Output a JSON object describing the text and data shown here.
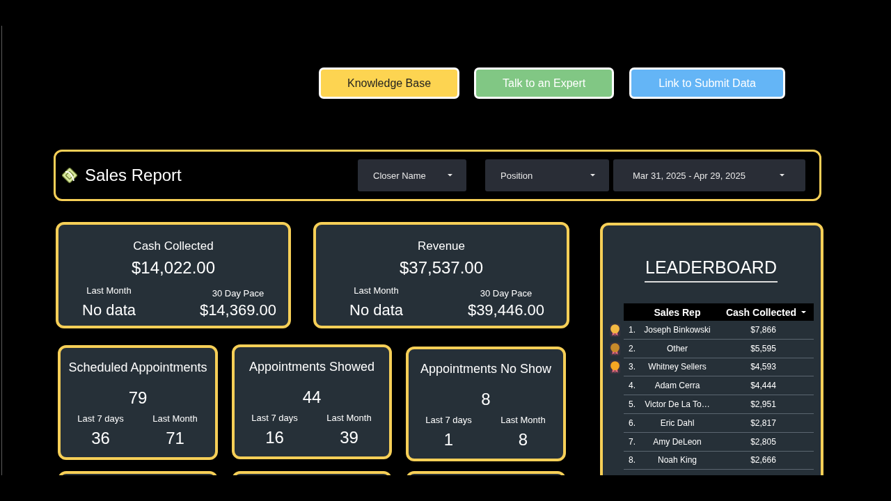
{
  "top_links": [
    {
      "label": "Knowledge Base",
      "color": "#fdd451"
    },
    {
      "label": "Talk to an Expert",
      "color": "#81c784"
    },
    {
      "label": "Link to Submit Data",
      "color": "#64b5f6"
    }
  ],
  "header": {
    "title": "Sales Report",
    "filters": [
      {
        "label": "Closer Name"
      },
      {
        "label": "Position"
      },
      {
        "label": "Mar 31, 2025 - Apr 29, 2025"
      }
    ]
  },
  "summary_cards": [
    {
      "title": "Cash Collected",
      "value": "$14,022.00",
      "last_month_label": "Last Month",
      "last_month_value": "No data",
      "pace_label": "30 Day Pace",
      "pace_value": "$14,369.00"
    },
    {
      "title": "Revenue",
      "value": "$37,537.00",
      "last_month_label": "Last Month",
      "last_month_value": "No data",
      "pace_label": "30 Day Pace",
      "pace_value": "$39,446.00"
    }
  ],
  "appointment_cards": [
    {
      "title": "Scheduled Appointments",
      "value": "79",
      "stats": [
        {
          "label": "Last 7 days",
          "value": "36"
        },
        {
          "label": "Last Month",
          "value": "71"
        }
      ]
    },
    {
      "title": "Appointments Showed",
      "value": "44",
      "stats": [
        {
          "label": "Last 7 days",
          "value": "16"
        },
        {
          "label": "Last Month",
          "value": "39"
        }
      ]
    },
    {
      "title": "Appointments No Show",
      "value": "8",
      "stats": [
        {
          "label": "Last 7 days",
          "value": "1"
        },
        {
          "label": "Last Month",
          "value": "8"
        }
      ]
    }
  ],
  "leaderboard": {
    "title": "LEADERBOARD",
    "columns": [
      {
        "label": "Sales Rep",
        "sorted": false
      },
      {
        "label": "Cash Collected",
        "sorted": true
      }
    ],
    "rows": [
      {
        "rank": "1.",
        "name": "Joseph Binkowski",
        "amount": "$7,866",
        "medal": true,
        "color": "#f4b942"
      },
      {
        "rank": "2.",
        "name": "Other",
        "amount": "$5,595",
        "medal": true,
        "color": "#c98a2a"
      },
      {
        "rank": "3.",
        "name": "Whitney Sellers",
        "amount": "$4,593",
        "medal": true,
        "color": "#f5a623"
      },
      {
        "rank": "4.",
        "name": "Adam Cerra",
        "amount": "$4,444",
        "medal": false
      },
      {
        "rank": "5.",
        "name": "Victor De La To…",
        "amount": "$2,951",
        "medal": false
      },
      {
        "rank": "6.",
        "name": "Eric Dahl",
        "amount": "$2,817",
        "medal": false
      },
      {
        "rank": "7.",
        "name": "Amy DeLeon",
        "amount": "$2,805",
        "medal": false
      },
      {
        "rank": "8.",
        "name": "Noah King",
        "amount": "$2,666",
        "medal": false
      }
    ]
  }
}
